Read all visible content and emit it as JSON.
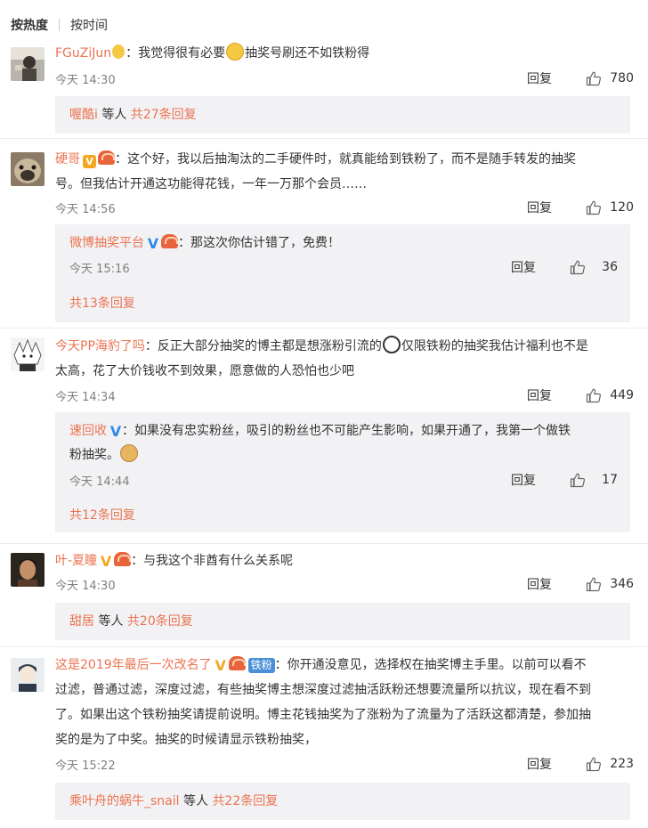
{
  "sort": {
    "active": "按热度",
    "other": "按时间"
  },
  "comments": [
    {
      "user": "FGuZiJun",
      "line1": "：我觉得很有必要",
      "line1b": "抽奖号刷还不如铁粉得",
      "time": "今天 14:30",
      "reply": "回复",
      "likes": "780",
      "more": {
        "name": "喔酷i",
        "mid": " 等人 ",
        "count": "共27条回复"
      }
    },
    {
      "user": "硬哥",
      "line1": "：这个好，我以后抽淘汰的二手硬件时，就真能给到铁粉了，而不是随手转发的抽奖",
      "line2": "号。但我估计开通这功能得花钱，一年一万那个会员……",
      "time": "今天 14:56",
      "reply": "回复",
      "likes": "120",
      "sub": {
        "user": "微博抽奖平台",
        "text": "：那这次你估计错了，免费！",
        "time": "今天 15:16",
        "reply": "回复",
        "likes": "36"
      },
      "more": {
        "count": "共13条回复"
      }
    },
    {
      "user": "今天PP海豹了吗",
      "line1a": "：反正大部分抽奖的博主都是想涨粉引流的",
      "line1b": "仅限铁粉的抽奖我估计福利也不是",
      "line2": "太高，花了大价钱收不到效果，愿意做的人恐怕也少吧",
      "time": "今天 14:34",
      "reply": "回复",
      "likes": "449",
      "sub": {
        "user": "速回收",
        "text": "：如果没有忠实粉丝，吸引的粉丝也不可能产生影响，如果开通了，我第一个做铁",
        "text2": "粉抽奖。",
        "time": "今天 14:44",
        "reply": "回复",
        "likes": "17"
      },
      "more": {
        "count": "共12条回复"
      }
    },
    {
      "user": "叶-夏瞳",
      "line1": "：与我这个非酋有什么关系呢",
      "time": "今天 14:30",
      "reply": "回复",
      "likes": "346",
      "more": {
        "name": "甜居",
        "mid": " 等人 ",
        "count": "共20条回复"
      }
    },
    {
      "user": "这是2019年最后一次改名了",
      "tiefen": "铁粉",
      "line1": "：你开通没意见，选择权在抽奖博主手里。以前可以看不",
      "line2": "过滤，普通过滤，深度过滤，有些抽奖博主想深度过滤抽活跃粉还想要流量所以抗议，现在看不到",
      "line3": "了。如果出这个铁粉抽奖请提前说明。博主花钱抽奖为了涨粉为了流量为了活跃这都清楚，参加抽",
      "line4": "奖的是为了中奖。抽奖的时候请显示铁粉抽奖，",
      "time": "今天 15:22",
      "reply": "回复",
      "likes": "223",
      "more": {
        "name": "乘叶舟的蜗牛_snail",
        "mid": " 等人 ",
        "count": "共22条回复"
      }
    }
  ]
}
